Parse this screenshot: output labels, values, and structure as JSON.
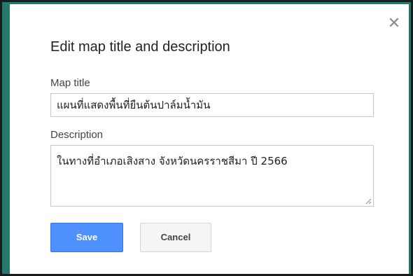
{
  "dialog": {
    "title": "Edit map title and description",
    "close_icon": "close-icon",
    "map_title": {
      "label": "Map title",
      "value": "แผนที่แสดงพื้นที่ยืนต้นปาล์มน้ำมัน"
    },
    "description": {
      "label": "Description",
      "value": "ในทางที่อำเภอเสิงสาง จังหวัดนครราชสีมา ปี 2566"
    },
    "buttons": {
      "save_label": "Save",
      "cancel_label": "Cancel"
    }
  },
  "colors": {
    "background": "#217a6b",
    "save_button": "#4d90fe"
  }
}
